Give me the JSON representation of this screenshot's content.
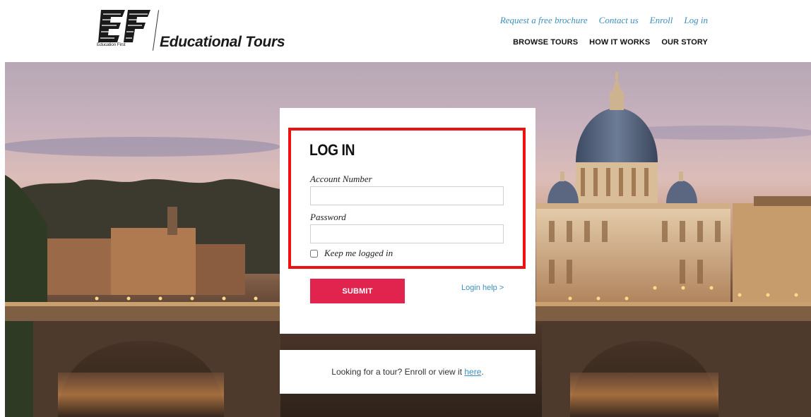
{
  "brand": {
    "logo_mark": "EF",
    "logo_sub": "Education First",
    "name": "Educational Tours"
  },
  "top_links": [
    {
      "label": "Request a free brochure"
    },
    {
      "label": "Contact us"
    },
    {
      "label": "Enroll"
    },
    {
      "label": "Log in"
    }
  ],
  "main_nav": [
    {
      "label": "BROWSE TOURS"
    },
    {
      "label": "HOW IT WORKS"
    },
    {
      "label": "OUR STORY"
    }
  ],
  "login": {
    "title": "LOG IN",
    "account_label": "Account Number",
    "account_value": "",
    "password_label": "Password",
    "password_value": "",
    "remember_label": "Keep me logged in",
    "remember_checked": false,
    "submit_label": "SUBMIT",
    "help_label": "Login help >"
  },
  "tour_prompt": {
    "text": "Looking for a tour? Enroll or view it ",
    "link_label": "here",
    "suffix": "."
  },
  "colors": {
    "accent_link": "#3b8fbf",
    "submit": "#e1244e",
    "highlight": "#ee1111"
  }
}
